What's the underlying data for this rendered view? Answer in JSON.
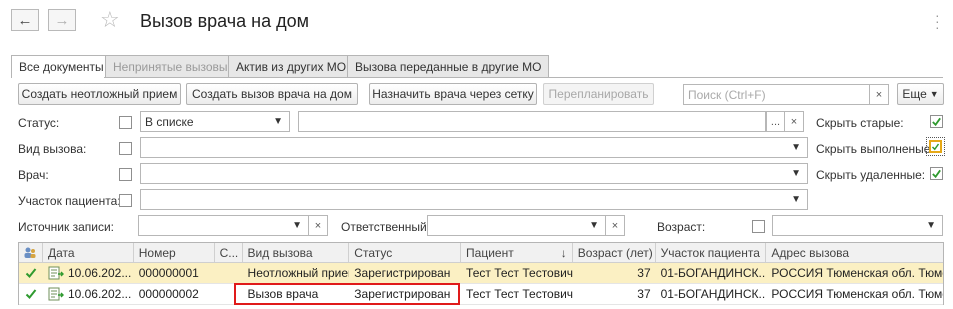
{
  "window": {
    "title": "Вызов врача на дом",
    "back_glyph": "←",
    "forward_glyph": "→",
    "star_glyph": "☆"
  },
  "tabs": [
    {
      "label": "Все документы",
      "state": "active"
    },
    {
      "label": "Непринятые вызовы",
      "state": "disabled"
    },
    {
      "label": "Актив из других МО",
      "state": "normal"
    },
    {
      "label": "Вызова переданные в другие МО",
      "state": "normal"
    }
  ],
  "toolbar": {
    "create_urgent": "Создать неотложный прием",
    "create_home_call": "Создать вызов врача на дом",
    "assign_doctor": "Назначить врача через сетку",
    "reschedule": "Перепланировать",
    "search_placeholder": "Поиск (Ctrl+F)",
    "more": "Еще"
  },
  "filters": {
    "status_label": "Статус:",
    "status_mode": "В списке",
    "call_type_label": "Вид вызова:",
    "doctor_label": "Врач:",
    "patient_area_label": "Участок пациента:",
    "source_label": "Источник записи:",
    "responsible_label": "Ответственный:",
    "age_label": "Возраст:",
    "hide_old_label": "Скрыть старые:",
    "hide_done_label": "Скрыть выполненые:",
    "hide_deleted_label": "Скрыть удаленные:",
    "dots_glyph": "...",
    "clear_glyph": "×",
    "dropdown_glyph": "▾"
  },
  "grid": {
    "columns": [
      "Дата",
      "Номер",
      "С...",
      "Вид вызова",
      "Статус",
      "Пациент",
      "Возраст (лет)",
      "Участок пациента",
      "Адрес вызова"
    ],
    "sort_glyph": "↓",
    "rows": [
      {
        "date": "10.06.202...",
        "number": "000000001",
        "s": "",
        "call_type": "Неотложный прием",
        "status": "Зарегистрирован",
        "patient": "Тест Тест Тестович",
        "age": "37",
        "area": "01-БОГАНДИНСК...",
        "address": "РОССИЯ Тюменская обл. Тюмень"
      },
      {
        "date": "10.06.202...",
        "number": "000000002",
        "s": "",
        "call_type": "Вызов врача",
        "status": "Зарегистрирован",
        "patient": "Тест Тест Тестович",
        "age": "37",
        "area": "01-БОГАНДИНСК...",
        "address": "РОССИЯ Тюменская обл. Тюмень"
      }
    ]
  },
  "colors": {
    "check_green": "#2f9a2f",
    "selected_row": "#fbf0c3",
    "highlight_red": "#e01a1a"
  }
}
